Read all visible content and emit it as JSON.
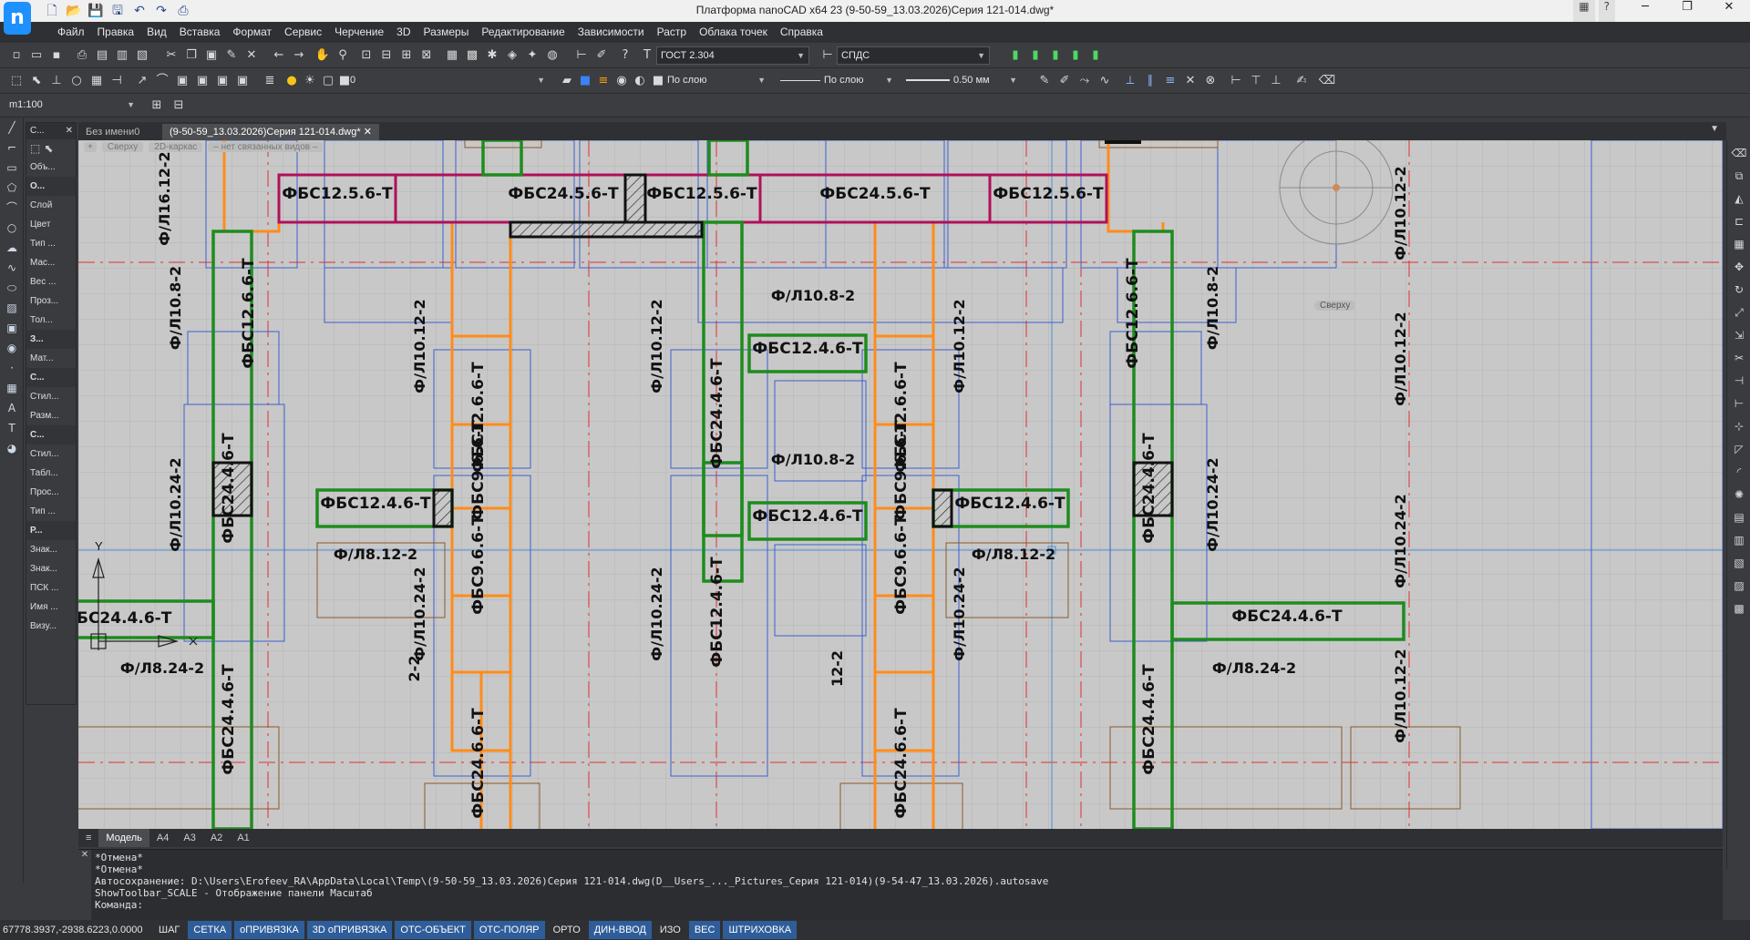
{
  "window": {
    "title": "Платформа nanoCAD x64 23 (9-50-59_13.03.2026)Серия 121-014.dwg*",
    "help": "?",
    "min": "─",
    "max": "❐",
    "close": "✕"
  },
  "menu": [
    "Файл",
    "Правка",
    "Вид",
    "Вставка",
    "Формат",
    "Сервис",
    "Черчение",
    "3D",
    "Размеры",
    "Редактирование",
    "Зависимости",
    "Растр",
    "Облака точек",
    "Справка"
  ],
  "toolbar": {
    "text_style": "ГОСТ 2.304",
    "dim_style": "СПДС",
    "layer": "0",
    "color": "По слою",
    "linetype": "По слою",
    "lineweight": "0.50 мм",
    "scale": "m1:100"
  },
  "properties_panel": {
    "title": "С...",
    "items": [
      "Объ...",
      "О...",
      "Слой",
      "Цвет",
      "Тип ...",
      "Мас...",
      "Вес ...",
      "Проз...",
      "Тол...",
      "З...",
      "Мат...",
      "С...",
      "Стил...",
      "Разм...",
      "С...",
      "Стил...",
      "Табл...",
      "Прос...",
      "Тип ...",
      "Р...",
      "Знак...",
      "Знак...",
      "ПСК ...",
      "Имя ...",
      "Визу..."
    ]
  },
  "doc_tabs": {
    "tab1": "Без имени0",
    "tab2": "(9-50-59_13.03.2026)Серия 121-014.dwg*"
  },
  "viewport_controls": {
    "plus": "+",
    "view": "Сверху",
    "style": "2D-каркас",
    "links": "– нет связанных видов –",
    "compass": "Сверху"
  },
  "drawing": {
    "labels_fbs": [
      "ФБС12.5.6-Т",
      "ФБС24.5.6-Т",
      "ФБС12.5.6-Т",
      "ФБС24.5.6-Т",
      "ФБС12.5.6-Т",
      "ФБС12.6.6-Т",
      "ФБС12.6.6-Т",
      "ФБС12.6.6-Т",
      "ФБС12.6.6-Т",
      "ФБС24.4.6-Т",
      "ФБС24.4.6-Т",
      "ФБС24.4.6-Т",
      "ФБС12.4.6-Т",
      "ФБС12.4.6-Т",
      "ФБС12.4.6-Т",
      "ФБС12.4.6-Т",
      "ФБС12.4.6-Т",
      "ФБС9.6.6-Т",
      "ФБС9.6.6-Т",
      "ФБС9.6.6-Т",
      "ФБС9.6.6-Т",
      "ФБС24.6.6-Т",
      "ФБС24.6.6-Т",
      "ФБС24.4.6-Т",
      "ФБС24.4.6-Т",
      "БС24.4.6-Т",
      "ФБС24.4.6-Т"
    ],
    "labels_fl": [
      "Ф/Л16.12-2",
      "Ф/Л10.8-2",
      "Ф/Л10.24-2",
      "Ф/Л10.12-2",
      "Ф/Л10.24-2",
      "Ф/Л10.12-2",
      "Ф/Л10.24-2",
      "Ф/Л10.8-2",
      "Ф/Л10.8-2",
      "Ф/Л10.12-2",
      "Ф/Л10.24-2",
      "Ф/Л10.8-2",
      "Ф/Л10.24-2",
      "Ф/Л8.12-2",
      "Ф/Л8.12-2",
      "Ф/Л8.24-2",
      "Ф/Л8.24-2",
      "Ф/Л10.12-2",
      "Ф/Л10.12-2",
      "Ф/Л10.24-2",
      "Ф/Л10.12-2",
      "Ф/Л10.12-2",
      "Ф/Л10.12-2",
      "Ф/Л10.12-2",
      "2-2",
      "12-2"
    ],
    "axis_y": "Y"
  },
  "layout_tabs": [
    "Модель",
    "A4",
    "A3",
    "A2",
    "A1"
  ],
  "command": {
    "side": "Командная...",
    "lines": [
      "*Отмена*",
      "*Отмена*",
      "Автосохранение: D:\\Users\\Erofeev_RA\\AppData\\Local\\Temp\\(9-50-59_13.03.2026)Серия 121-014.dwg(D__Users_..._Pictures_Серия 121-014)(9-54-47_13.03.2026).autosave",
      "ShowToolbar_SCALE - Отображение панели Масштаб",
      "Команда:"
    ]
  },
  "status": {
    "coords": "67778.3937,-2938.6223,0.0000",
    "buttons": [
      {
        "label": "ШАГ",
        "on": false
      },
      {
        "label": "СЕТКА",
        "on": true
      },
      {
        "label": "оПРИВЯЗКА",
        "on": true
      },
      {
        "label": "3D оПРИВЯЗКА",
        "on": true
      },
      {
        "label": "ОТС-ОБЪЕКТ",
        "on": true
      },
      {
        "label": "ОТС-ПОЛЯР",
        "on": true
      },
      {
        "label": "ОРТО",
        "on": false
      },
      {
        "label": "ДИН-ВВОД",
        "on": true
      },
      {
        "label": "ИЗО",
        "on": false
      },
      {
        "label": "ВЕС",
        "on": true
      },
      {
        "label": "ШТРИХОВКА",
        "on": true
      }
    ]
  },
  "colors": {
    "fbs_orange": "#ff8c1a",
    "fbs_green": "#1e8c1e",
    "fbs_magenta": "#b0105a",
    "outline_blue": "#3b5fcf",
    "axis_red": "#e03030",
    "status_on": "#2f5d9a"
  }
}
